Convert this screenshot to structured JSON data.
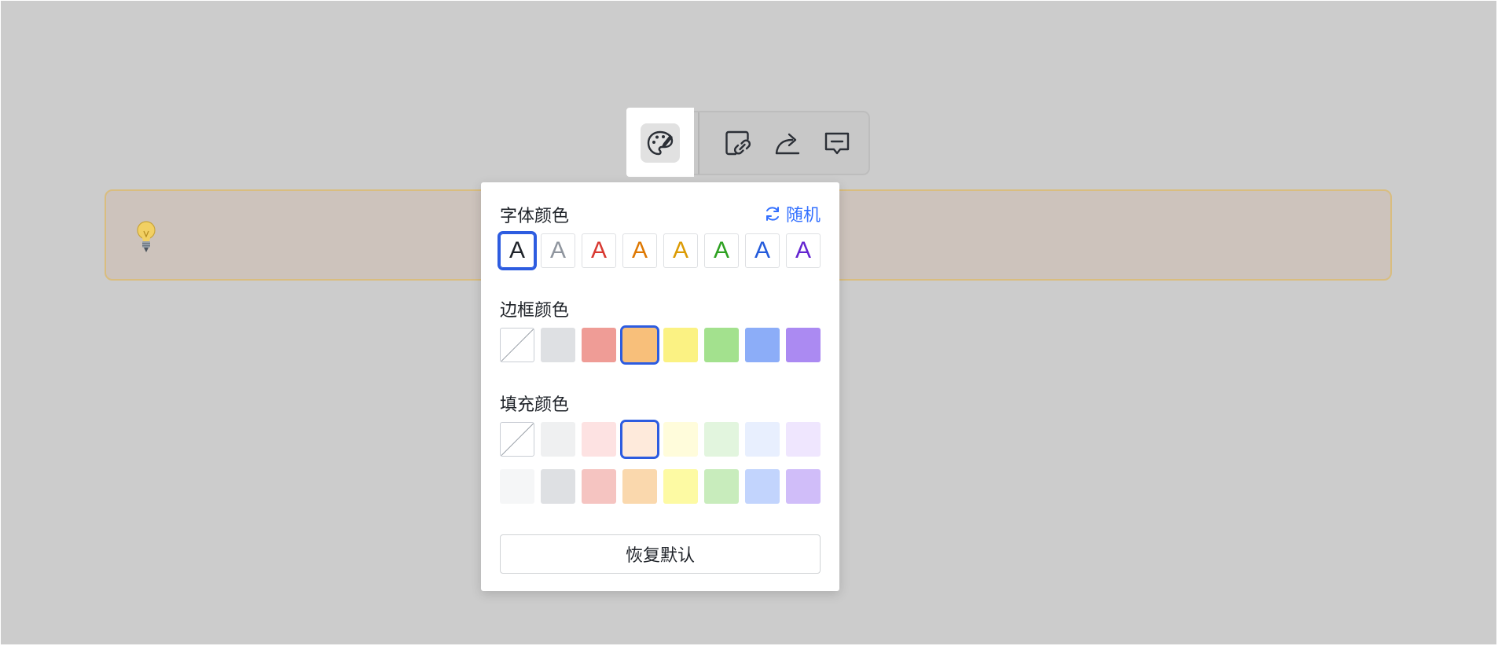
{
  "toolbar": {
    "buttons": [
      {
        "icon": "palette-icon",
        "active": true
      },
      {
        "icon": "link-icon",
        "active": false
      },
      {
        "icon": "share-arrow-icon",
        "active": false
      },
      {
        "icon": "comment-icon",
        "active": false
      }
    ]
  },
  "callout": {
    "icon": "lightbulb-icon"
  },
  "panel": {
    "font_color_title": "字体颜色",
    "random_label": "随机",
    "border_color_title": "边框颜色",
    "fill_color_title": "填充颜色",
    "restore_label": "恢复默认",
    "font_letter": "A",
    "font_colors": [
      "#1f2329",
      "#8f959e",
      "#d83931",
      "#de7802",
      "#dc9b04",
      "#2ea121",
      "#245bdb",
      "#6425d0"
    ],
    "font_selected_index": 0,
    "border_colors": [
      "none",
      "#dee0e3",
      "#ef9c96",
      "#f8bf7a",
      "#fbf283",
      "#a3e18e",
      "#8cadf8",
      "#ab8af2"
    ],
    "border_selected_index": 3,
    "fill_colors_row1": [
      "none",
      "#eff0f1",
      "#fde2e2",
      "#feeadb",
      "#fffcdb",
      "#e2f5de",
      "#e8effe",
      "#efe6fe"
    ],
    "fill_colors_row2": [
      "#f5f6f7",
      "#dee0e3",
      "#f5c4c1",
      "#fad8ad",
      "#fdfaa3",
      "#c8ecbc",
      "#c2d4fd",
      "#d0bdf9"
    ],
    "fill_selected_index": 3,
    "accent_color": "#2d5ce0"
  }
}
